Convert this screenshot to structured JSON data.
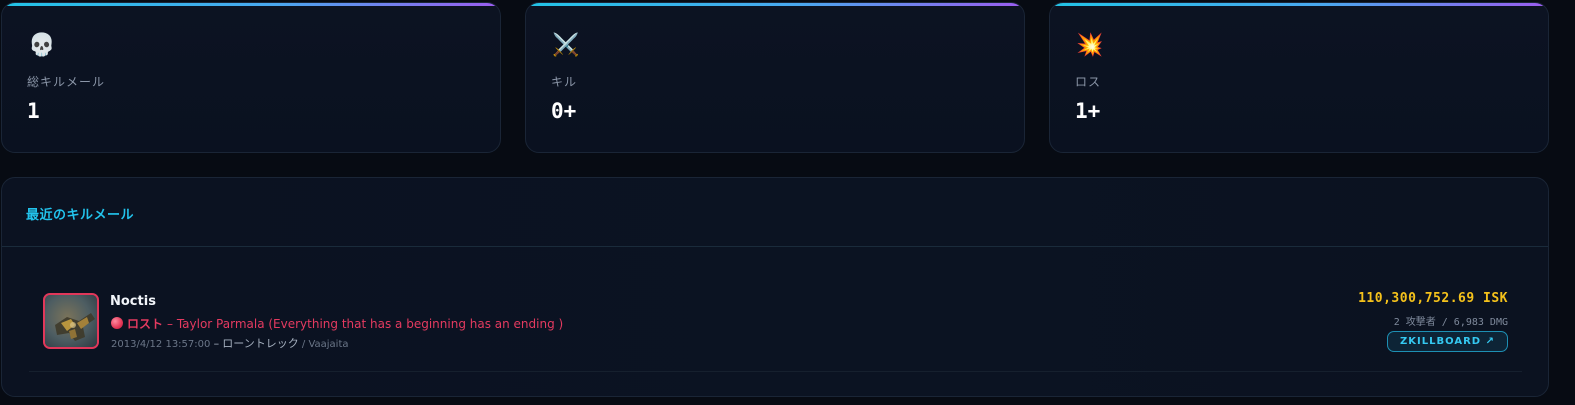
{
  "stats": [
    {
      "icon": "💀",
      "icon_name": "skull-icon",
      "label": "総キルメール",
      "value": "1"
    },
    {
      "icon": "⚔️",
      "icon_name": "crossed-swords-icon",
      "label": "キル",
      "value": "0+"
    },
    {
      "icon": "💥",
      "icon_name": "explosion-icon",
      "label": "ロス",
      "value": "1+"
    }
  ],
  "recent": {
    "title": "最近のキルメール",
    "killmails": [
      {
        "ship": "Noctis",
        "type_label": "ロスト",
        "victim": "– Taylor Parmala (Everything that has a beginning has an ending )",
        "datetime": "2013/4/12 13:57:00",
        "separator": "–",
        "system": "ローントレック",
        "region": "/ Vaajaita",
        "isk": "110,300,752.69 ISK",
        "attackers": "2 攻撃者 / 6,983 DMG",
        "link_label": "ZKILLBOARD ↗"
      }
    ]
  },
  "colors": {
    "accent": "#22c3ec",
    "loss": "#e43a60",
    "isk": "#f5c21b",
    "gradient_start": "#22c3e6",
    "gradient_end": "#9b5cf0"
  }
}
